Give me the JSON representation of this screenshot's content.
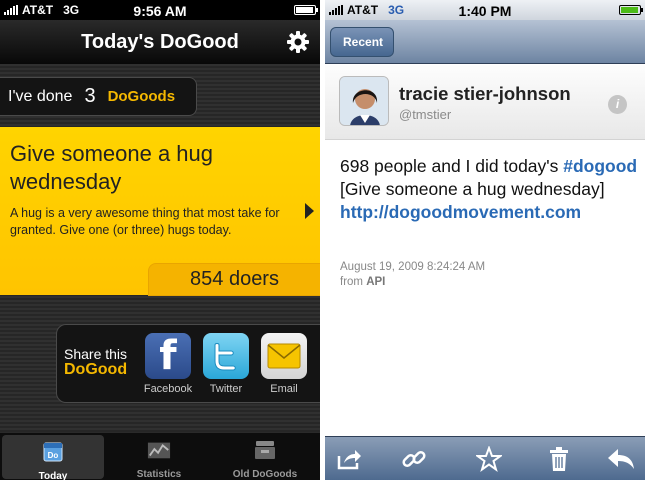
{
  "left_app": {
    "status": {
      "carrier": "AT&T",
      "network": "3G",
      "time": "9:56 AM"
    },
    "nav_title": "Today's DoGood",
    "counter": {
      "prefix": "I've done",
      "count": "3",
      "unit": "DoGoods"
    },
    "dogood": {
      "title": "Give someone a hug wednesday",
      "description": "A hug is a very awesome thing that most take for granted. Give one (or three) hugs today.",
      "doers": "854 doers"
    },
    "share": {
      "label_line1": "Share this",
      "label_line2": "DoGood",
      "buttons": [
        {
          "label": "Facebook",
          "icon": "facebook-icon"
        },
        {
          "label": "Twitter",
          "icon": "twitter-icon"
        },
        {
          "label": "Email",
          "icon": "email-icon"
        }
      ]
    },
    "tabs": [
      {
        "label": "Today",
        "icon": "calendar-icon",
        "selected": true
      },
      {
        "label": "Statistics",
        "icon": "chart-icon",
        "selected": false
      },
      {
        "label": "Old DoGoods",
        "icon": "archive-icon",
        "selected": false
      }
    ],
    "colors": {
      "accent": "#f5b800",
      "card": "#ffd400"
    }
  },
  "right_app": {
    "status": {
      "carrier": "AT&T",
      "network": "3G",
      "time": "1:40 PM"
    },
    "back_label": "Recent",
    "user": {
      "name": "tracie stier-johnson",
      "handle": "@tmstier"
    },
    "tweet": {
      "text_before": "698 people and I did today's ",
      "hashtag": "#dogood",
      "text_after": " [Give someone a hug wednesday]",
      "link": "http://dogoodmovement.com",
      "date": "August 19, 2009 8:24:24 AM",
      "from_prefix": "from",
      "from_source": "API"
    },
    "toolbar": [
      "share-icon",
      "link-icon",
      "star-icon",
      "trash-icon",
      "reply-icon"
    ],
    "colors": {
      "link": "#2a6ab5",
      "navbar": "#6d84a2"
    }
  }
}
